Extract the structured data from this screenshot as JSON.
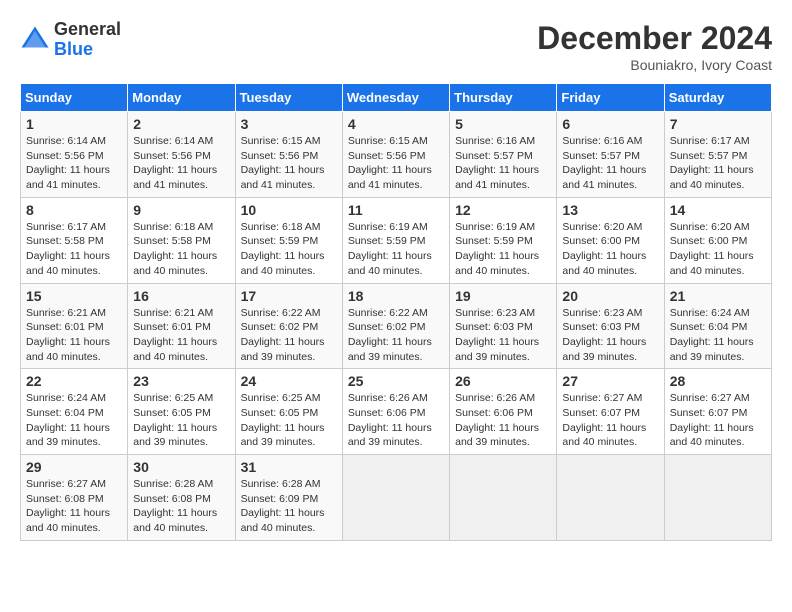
{
  "header": {
    "logo_general": "General",
    "logo_blue": "Blue",
    "month_title": "December 2024",
    "location": "Bouniakro, Ivory Coast"
  },
  "weekdays": [
    "Sunday",
    "Monday",
    "Tuesday",
    "Wednesday",
    "Thursday",
    "Friday",
    "Saturday"
  ],
  "weeks": [
    [
      {
        "day": "1",
        "info": "Sunrise: 6:14 AM\nSunset: 5:56 PM\nDaylight: 11 hours and 41 minutes."
      },
      {
        "day": "2",
        "info": "Sunrise: 6:14 AM\nSunset: 5:56 PM\nDaylight: 11 hours and 41 minutes."
      },
      {
        "day": "3",
        "info": "Sunrise: 6:15 AM\nSunset: 5:56 PM\nDaylight: 11 hours and 41 minutes."
      },
      {
        "day": "4",
        "info": "Sunrise: 6:15 AM\nSunset: 5:56 PM\nDaylight: 11 hours and 41 minutes."
      },
      {
        "day": "5",
        "info": "Sunrise: 6:16 AM\nSunset: 5:57 PM\nDaylight: 11 hours and 41 minutes."
      },
      {
        "day": "6",
        "info": "Sunrise: 6:16 AM\nSunset: 5:57 PM\nDaylight: 11 hours and 41 minutes."
      },
      {
        "day": "7",
        "info": "Sunrise: 6:17 AM\nSunset: 5:57 PM\nDaylight: 11 hours and 40 minutes."
      }
    ],
    [
      {
        "day": "8",
        "info": "Sunrise: 6:17 AM\nSunset: 5:58 PM\nDaylight: 11 hours and 40 minutes."
      },
      {
        "day": "9",
        "info": "Sunrise: 6:18 AM\nSunset: 5:58 PM\nDaylight: 11 hours and 40 minutes."
      },
      {
        "day": "10",
        "info": "Sunrise: 6:18 AM\nSunset: 5:59 PM\nDaylight: 11 hours and 40 minutes."
      },
      {
        "day": "11",
        "info": "Sunrise: 6:19 AM\nSunset: 5:59 PM\nDaylight: 11 hours and 40 minutes."
      },
      {
        "day": "12",
        "info": "Sunrise: 6:19 AM\nSunset: 5:59 PM\nDaylight: 11 hours and 40 minutes."
      },
      {
        "day": "13",
        "info": "Sunrise: 6:20 AM\nSunset: 6:00 PM\nDaylight: 11 hours and 40 minutes."
      },
      {
        "day": "14",
        "info": "Sunrise: 6:20 AM\nSunset: 6:00 PM\nDaylight: 11 hours and 40 minutes."
      }
    ],
    [
      {
        "day": "15",
        "info": "Sunrise: 6:21 AM\nSunset: 6:01 PM\nDaylight: 11 hours and 40 minutes."
      },
      {
        "day": "16",
        "info": "Sunrise: 6:21 AM\nSunset: 6:01 PM\nDaylight: 11 hours and 40 minutes."
      },
      {
        "day": "17",
        "info": "Sunrise: 6:22 AM\nSunset: 6:02 PM\nDaylight: 11 hours and 39 minutes."
      },
      {
        "day": "18",
        "info": "Sunrise: 6:22 AM\nSunset: 6:02 PM\nDaylight: 11 hours and 39 minutes."
      },
      {
        "day": "19",
        "info": "Sunrise: 6:23 AM\nSunset: 6:03 PM\nDaylight: 11 hours and 39 minutes."
      },
      {
        "day": "20",
        "info": "Sunrise: 6:23 AM\nSunset: 6:03 PM\nDaylight: 11 hours and 39 minutes."
      },
      {
        "day": "21",
        "info": "Sunrise: 6:24 AM\nSunset: 6:04 PM\nDaylight: 11 hours and 39 minutes."
      }
    ],
    [
      {
        "day": "22",
        "info": "Sunrise: 6:24 AM\nSunset: 6:04 PM\nDaylight: 11 hours and 39 minutes."
      },
      {
        "day": "23",
        "info": "Sunrise: 6:25 AM\nSunset: 6:05 PM\nDaylight: 11 hours and 39 minutes."
      },
      {
        "day": "24",
        "info": "Sunrise: 6:25 AM\nSunset: 6:05 PM\nDaylight: 11 hours and 39 minutes."
      },
      {
        "day": "25",
        "info": "Sunrise: 6:26 AM\nSunset: 6:06 PM\nDaylight: 11 hours and 39 minutes."
      },
      {
        "day": "26",
        "info": "Sunrise: 6:26 AM\nSunset: 6:06 PM\nDaylight: 11 hours and 39 minutes."
      },
      {
        "day": "27",
        "info": "Sunrise: 6:27 AM\nSunset: 6:07 PM\nDaylight: 11 hours and 40 minutes."
      },
      {
        "day": "28",
        "info": "Sunrise: 6:27 AM\nSunset: 6:07 PM\nDaylight: 11 hours and 40 minutes."
      }
    ],
    [
      {
        "day": "29",
        "info": "Sunrise: 6:27 AM\nSunset: 6:08 PM\nDaylight: 11 hours and 40 minutes."
      },
      {
        "day": "30",
        "info": "Sunrise: 6:28 AM\nSunset: 6:08 PM\nDaylight: 11 hours and 40 minutes."
      },
      {
        "day": "31",
        "info": "Sunrise: 6:28 AM\nSunset: 6:09 PM\nDaylight: 11 hours and 40 minutes."
      },
      null,
      null,
      null,
      null
    ]
  ]
}
